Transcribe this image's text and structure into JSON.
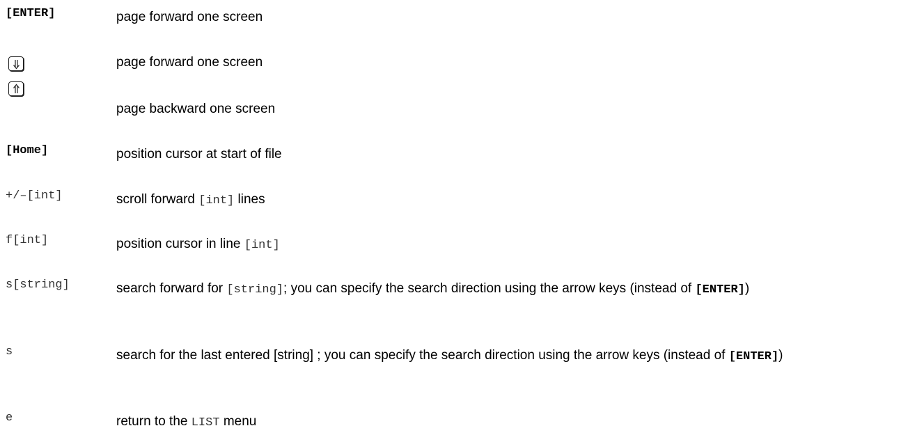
{
  "rows": [
    {
      "key": "[ENTER]",
      "desc": "page forward one screen"
    },
    {
      "key_icon": "double-arrow-down-icon",
      "desc": "page forward one screen"
    },
    {
      "key_icon": "double-arrow-up-icon",
      "desc": "page backward one screen"
    },
    {
      "key": "[Home]",
      "desc": "position cursor at start of file"
    },
    {
      "key": "+/–[int]",
      "desc_parts": [
        "scroll forward ",
        "[int]",
        " lines"
      ]
    },
    {
      "key": "f[int]",
      "desc_parts": [
        "position cursor in line ",
        "[int]"
      ]
    },
    {
      "key": "s[string]",
      "desc_parts": [
        "search forward for ",
        "[string]",
        "; you can specify the search direction using the arrow keys (instead of ",
        "[ENTER]",
        ")"
      ]
    },
    {
      "key": "s",
      "desc_parts": [
        "search for the last entered [string] ; you can specify the search direction using the arrow keys (instead of ",
        "[ENTER]",
        ")"
      ]
    },
    {
      "key": "e",
      "desc_parts": [
        "return to the ",
        "LIST",
        " menu"
      ]
    }
  ]
}
